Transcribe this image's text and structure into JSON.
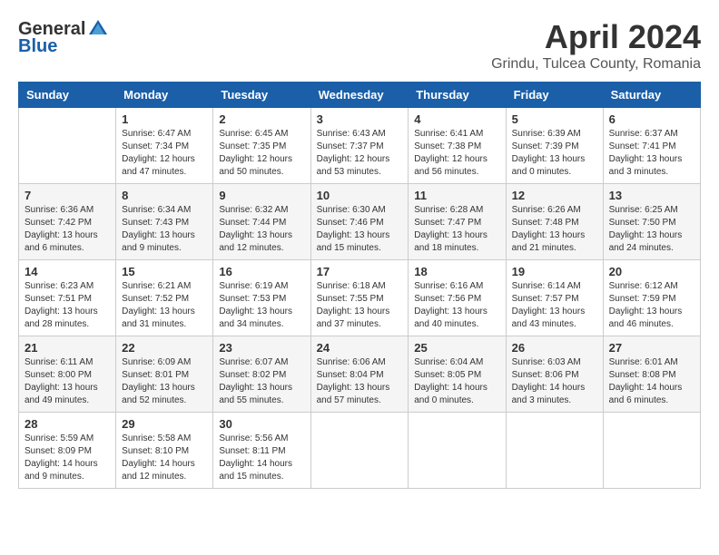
{
  "header": {
    "logo_general": "General",
    "logo_blue": "Blue",
    "title": "April 2024",
    "location": "Grindu, Tulcea County, Romania"
  },
  "columns": [
    "Sunday",
    "Monday",
    "Tuesday",
    "Wednesday",
    "Thursday",
    "Friday",
    "Saturday"
  ],
  "weeks": [
    [
      {
        "day": "",
        "info": ""
      },
      {
        "day": "1",
        "info": "Sunrise: 6:47 AM\nSunset: 7:34 PM\nDaylight: 12 hours\nand 47 minutes."
      },
      {
        "day": "2",
        "info": "Sunrise: 6:45 AM\nSunset: 7:35 PM\nDaylight: 12 hours\nand 50 minutes."
      },
      {
        "day": "3",
        "info": "Sunrise: 6:43 AM\nSunset: 7:37 PM\nDaylight: 12 hours\nand 53 minutes."
      },
      {
        "day": "4",
        "info": "Sunrise: 6:41 AM\nSunset: 7:38 PM\nDaylight: 12 hours\nand 56 minutes."
      },
      {
        "day": "5",
        "info": "Sunrise: 6:39 AM\nSunset: 7:39 PM\nDaylight: 13 hours\nand 0 minutes."
      },
      {
        "day": "6",
        "info": "Sunrise: 6:37 AM\nSunset: 7:41 PM\nDaylight: 13 hours\nand 3 minutes."
      }
    ],
    [
      {
        "day": "7",
        "info": "Sunrise: 6:36 AM\nSunset: 7:42 PM\nDaylight: 13 hours\nand 6 minutes."
      },
      {
        "day": "8",
        "info": "Sunrise: 6:34 AM\nSunset: 7:43 PM\nDaylight: 13 hours\nand 9 minutes."
      },
      {
        "day": "9",
        "info": "Sunrise: 6:32 AM\nSunset: 7:44 PM\nDaylight: 13 hours\nand 12 minutes."
      },
      {
        "day": "10",
        "info": "Sunrise: 6:30 AM\nSunset: 7:46 PM\nDaylight: 13 hours\nand 15 minutes."
      },
      {
        "day": "11",
        "info": "Sunrise: 6:28 AM\nSunset: 7:47 PM\nDaylight: 13 hours\nand 18 minutes."
      },
      {
        "day": "12",
        "info": "Sunrise: 6:26 AM\nSunset: 7:48 PM\nDaylight: 13 hours\nand 21 minutes."
      },
      {
        "day": "13",
        "info": "Sunrise: 6:25 AM\nSunset: 7:50 PM\nDaylight: 13 hours\nand 24 minutes."
      }
    ],
    [
      {
        "day": "14",
        "info": "Sunrise: 6:23 AM\nSunset: 7:51 PM\nDaylight: 13 hours\nand 28 minutes."
      },
      {
        "day": "15",
        "info": "Sunrise: 6:21 AM\nSunset: 7:52 PM\nDaylight: 13 hours\nand 31 minutes."
      },
      {
        "day": "16",
        "info": "Sunrise: 6:19 AM\nSunset: 7:53 PM\nDaylight: 13 hours\nand 34 minutes."
      },
      {
        "day": "17",
        "info": "Sunrise: 6:18 AM\nSunset: 7:55 PM\nDaylight: 13 hours\nand 37 minutes."
      },
      {
        "day": "18",
        "info": "Sunrise: 6:16 AM\nSunset: 7:56 PM\nDaylight: 13 hours\nand 40 minutes."
      },
      {
        "day": "19",
        "info": "Sunrise: 6:14 AM\nSunset: 7:57 PM\nDaylight: 13 hours\nand 43 minutes."
      },
      {
        "day": "20",
        "info": "Sunrise: 6:12 AM\nSunset: 7:59 PM\nDaylight: 13 hours\nand 46 minutes."
      }
    ],
    [
      {
        "day": "21",
        "info": "Sunrise: 6:11 AM\nSunset: 8:00 PM\nDaylight: 13 hours\nand 49 minutes."
      },
      {
        "day": "22",
        "info": "Sunrise: 6:09 AM\nSunset: 8:01 PM\nDaylight: 13 hours\nand 52 minutes."
      },
      {
        "day": "23",
        "info": "Sunrise: 6:07 AM\nSunset: 8:02 PM\nDaylight: 13 hours\nand 55 minutes."
      },
      {
        "day": "24",
        "info": "Sunrise: 6:06 AM\nSunset: 8:04 PM\nDaylight: 13 hours\nand 57 minutes."
      },
      {
        "day": "25",
        "info": "Sunrise: 6:04 AM\nSunset: 8:05 PM\nDaylight: 14 hours\nand 0 minutes."
      },
      {
        "day": "26",
        "info": "Sunrise: 6:03 AM\nSunset: 8:06 PM\nDaylight: 14 hours\nand 3 minutes."
      },
      {
        "day": "27",
        "info": "Sunrise: 6:01 AM\nSunset: 8:08 PM\nDaylight: 14 hours\nand 6 minutes."
      }
    ],
    [
      {
        "day": "28",
        "info": "Sunrise: 5:59 AM\nSunset: 8:09 PM\nDaylight: 14 hours\nand 9 minutes."
      },
      {
        "day": "29",
        "info": "Sunrise: 5:58 AM\nSunset: 8:10 PM\nDaylight: 14 hours\nand 12 minutes."
      },
      {
        "day": "30",
        "info": "Sunrise: 5:56 AM\nSunset: 8:11 PM\nDaylight: 14 hours\nand 15 minutes."
      },
      {
        "day": "",
        "info": ""
      },
      {
        "day": "",
        "info": ""
      },
      {
        "day": "",
        "info": ""
      },
      {
        "day": "",
        "info": ""
      }
    ]
  ]
}
